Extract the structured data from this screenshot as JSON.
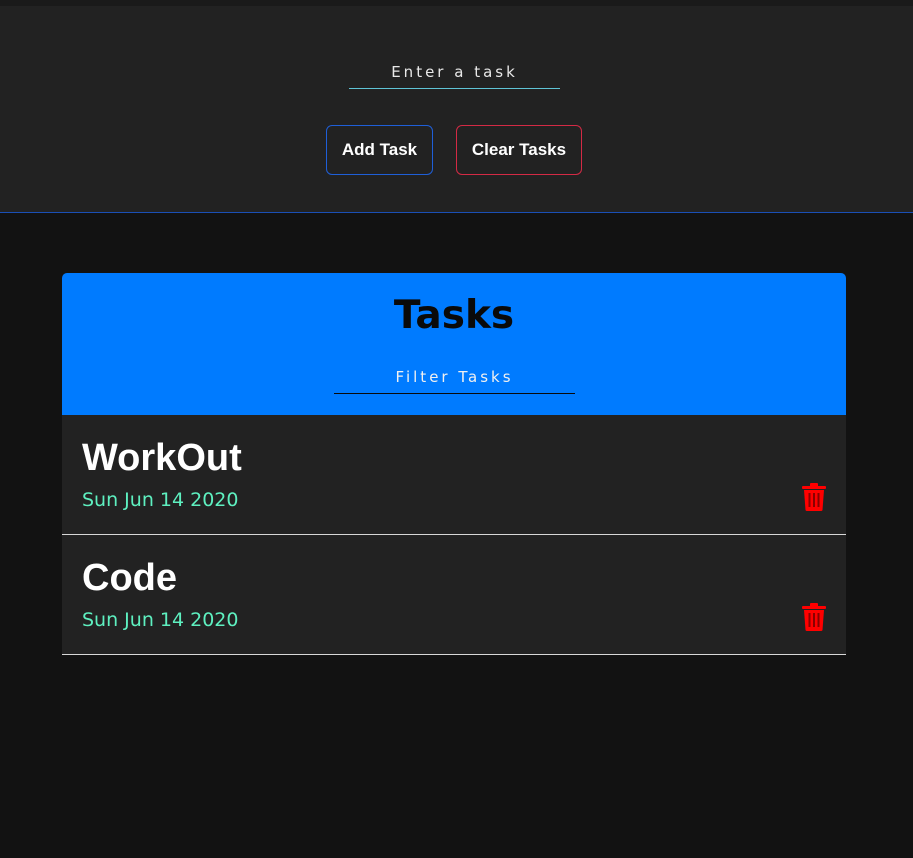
{
  "input": {
    "task_placeholder": "Enter a task"
  },
  "buttons": {
    "add_label": "Add Task",
    "clear_label": "Clear Tasks"
  },
  "panel": {
    "title": "Tasks",
    "filter_placeholder": "Filter Tasks"
  },
  "tasks": [
    {
      "name": "WorkOut",
      "date": "Sun Jun 14 2020"
    },
    {
      "name": "Code",
      "date": "Sun Jun 14 2020"
    }
  ],
  "icons": {
    "delete": "trash-icon"
  },
  "colors": {
    "accent_blue": "#007bff",
    "add_border": "#1f5fd8",
    "clear_border": "#d42a45",
    "date_text": "#5ef0c0",
    "delete_icon": "#ff0000"
  }
}
